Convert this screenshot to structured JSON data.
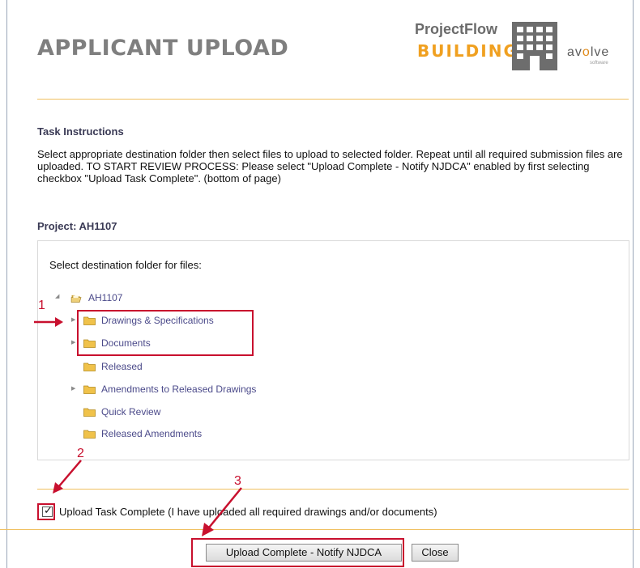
{
  "header": {
    "title": "APPLICANT UPLOAD",
    "logo": {
      "product_line1": "ProjectFlow",
      "product_line2": "BUILDING",
      "company": "avolve",
      "company_tagline": "software"
    }
  },
  "instructions": {
    "heading": "Task Instructions",
    "body": "Select appropriate destination folder then select files to upload to selected folder. Repeat until all required submission files are uploaded. TO START REVIEW PROCESS: Please select \"Upload Complete - Notify NJDCA\" enabled by first selecting checkbox \"Upload Task Complete\". (bottom of page)"
  },
  "project": {
    "heading": "Project: AH1107"
  },
  "folder_tree": {
    "prompt": "Select destination folder for files:",
    "root": {
      "label": "AH1107",
      "icon": "open-folder-icon",
      "expanded": true
    },
    "items": [
      {
        "label": "Drawings & Specifications",
        "has_children": true
      },
      {
        "label": "Documents",
        "has_children": true
      },
      {
        "label": "Released",
        "has_children": false
      },
      {
        "label": "Amendments to Released Drawings",
        "has_children": true
      },
      {
        "label": "Quick Review",
        "has_children": false
      },
      {
        "label": "Released Amendments",
        "has_children": false
      }
    ]
  },
  "completion": {
    "checkbox_checked": true,
    "checkbox_label": "Upload Task Complete (I have uploaded all required drawings and/or documents)"
  },
  "actions": {
    "notify_label": "Upload Complete - Notify NJDCA",
    "close_label": "Close"
  },
  "annotations": {
    "callout_1": "1",
    "callout_2": "2",
    "callout_3": "3"
  },
  "colors": {
    "title_gray": "#7f7f7f",
    "accent_orange": "#f0a020",
    "rule_gold": "#f0c060",
    "tree_link": "#4b4a8a",
    "annotation_red": "#c8102e"
  }
}
